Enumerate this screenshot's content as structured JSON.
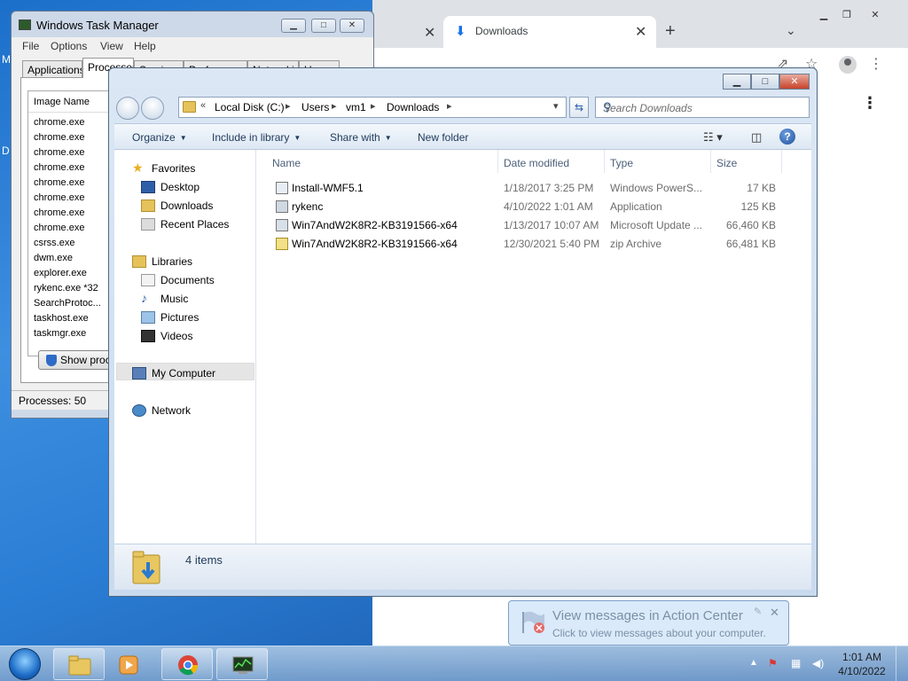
{
  "chrome": {
    "tab_active_label": "Downloads"
  },
  "task_manager": {
    "title": "Windows Task Manager",
    "menu": [
      "File",
      "Options",
      "View",
      "Help"
    ],
    "tabs": [
      "Applications",
      "Processes",
      "Services",
      "Performance",
      "Networking",
      "Users"
    ],
    "column_header": "Image Name",
    "processes": [
      "chrome.exe",
      "chrome.exe",
      "chrome.exe",
      "chrome.exe",
      "chrome.exe",
      "chrome.exe",
      "chrome.exe",
      "chrome.exe",
      "csrss.exe",
      "dwm.exe",
      "explorer.exe",
      "rykenc.exe *32",
      "SearchProtoc...",
      "taskhost.exe",
      "taskmgr.exe"
    ],
    "show_button": "Show processes from all users",
    "status": "Processes: 50"
  },
  "explorer": {
    "breadcrumb": [
      "Local Disk (C:)",
      "Users",
      "vm1",
      "Downloads"
    ],
    "search_placeholder": "Search Downloads",
    "commands": {
      "organize": "Organize",
      "include": "Include in library",
      "share": "Share with",
      "new_folder": "New folder"
    },
    "nav": {
      "favorites": "Favorites",
      "desktop": "Desktop",
      "downloads": "Downloads",
      "recent": "Recent Places",
      "libraries": "Libraries",
      "documents": "Documents",
      "music": "Music",
      "pictures": "Pictures",
      "videos": "Videos",
      "computer": "My Computer",
      "network": "Network"
    },
    "columns": {
      "name": "Name",
      "date": "Date modified",
      "type": "Type",
      "size": "Size"
    },
    "files": [
      {
        "name": "Install-WMF5.1",
        "date": "1/18/2017 3:25 PM",
        "type": "Windows PowerS...",
        "size": "17 KB"
      },
      {
        "name": "rykenc",
        "date": "4/10/2022 1:01 AM",
        "type": "Application",
        "size": "125 KB"
      },
      {
        "name": "Win7AndW2K8R2-KB3191566-x64",
        "date": "1/13/2017 10:07 AM",
        "type": "Microsoft Update ...",
        "size": "66,460 KB"
      },
      {
        "name": "Win7AndW2K8R2-KB3191566-x64",
        "date": "12/30/2021 5:40 PM",
        "type": "zip Archive",
        "size": "66,481 KB"
      }
    ],
    "item_count": "4 items"
  },
  "notification": {
    "title": "View messages in Action Center",
    "body": "Click to view messages about your computer."
  },
  "taskbar": {
    "time": "1:01 AM",
    "date": "4/10/2022"
  },
  "desktop_labels": [
    "M",
    "D"
  ]
}
